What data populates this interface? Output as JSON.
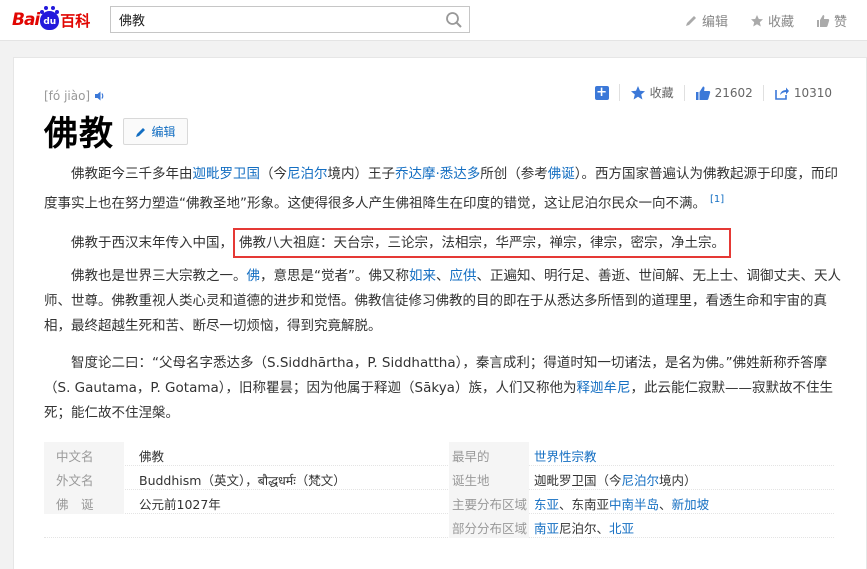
{
  "topbar": {
    "logo_bai": "Bai",
    "logo_du": "du",
    "logo_baike": "百科",
    "search_value": "佛教",
    "actions": {
      "edit": "编辑",
      "fav": "收藏",
      "like": "赞"
    }
  },
  "entry": {
    "pinyin": "[fó jiào]",
    "title": "佛教",
    "edit_label": "编辑",
    "tools": {
      "fav": "收藏",
      "likes": "21602",
      "shares": "10310"
    }
  },
  "paragraphs": {
    "p1": {
      "t1": "佛教距今三千多年由",
      "l1": "迦毗罗卫国",
      "t2": "（今",
      "l2": "尼泊尔",
      "t3": "境内）王子",
      "l3": "乔达摩·悉达多",
      "t4": "所创（参考",
      "l4": "佛诞",
      "t5": "）。西方国家普遍认为佛教起源于印度，而印度事实上也在努力塑造“佛教圣地”形象。这使得很多人产生佛祖降生在印度的错觉，这让尼泊尔民众一向不满。",
      "ref": "[1]"
    },
    "p2": {
      "t1": "佛教于西汉末年传入中国，",
      "highlight": "佛教八大祖庭：天台宗，三论宗，法相宗，华严宗，禅宗，律宗，密宗，净土宗。"
    },
    "p3": {
      "t1": "佛教也是世界三大宗教之一。",
      "l1": "佛",
      "t2": "，意思是“觉者”。佛又称",
      "l2": "如来",
      "t3": "、",
      "l3": "应供",
      "t4": "、正遍知、明行足、善逝、世间解、无上士、调御丈夫、天人师、世尊。佛教重视人类心灵和道德的进步和觉悟。佛教信徒修习佛教的目的即在于从悉达多所悟到的道理里，看透生命和宇宙的真相，最终超越生死和苦、断尽一切烦恼，得到究竟解脱。"
    },
    "p4": {
      "t1": "智度论二曰：“父母名字悉达多（S.Siddhārtha，P. Siddhattha），秦言成利；得道时知一切诸法，是名为佛。”佛姓新称乔答摩（S. Gautama，P. Gotama），旧称瞿昙；因为他属于释迦（Sākya）族，人们又称他为",
      "l1": "释迦牟尼",
      "t2": "，此云能仁寂默——寂默故不住生死；能仁故不住涅槃。"
    }
  },
  "info": {
    "r1": {
      "label": "中文名",
      "value": "佛教",
      "label2": "最早的",
      "v2a": "世界性",
      "v2b": "宗教"
    },
    "r2": {
      "label": "外文名",
      "value": "Buddhism（英文），बौद्धधर्मः（梵文）",
      "label2": "诞生地",
      "v2a": "迦毗罗卫国（今",
      "v2b": "尼泊尔",
      "v2c": "境内）"
    },
    "r3": {
      "label": "佛　诞",
      "value": "公元前1027年",
      "label2": "主要分布区域",
      "v2a": "东亚",
      "v2b": "、东南亚",
      "v2c": "中南半岛",
      "v2d": "、",
      "v2e": "新加坡"
    },
    "r4": {
      "label2": "部分分布区域",
      "v2a": "南亚",
      "v2b": "尼泊尔、",
      "v2c": "北亚"
    }
  },
  "colors": {
    "link": "#136ec2",
    "highlight_border": "#e53935",
    "logo_red": "#e10602",
    "logo_blue": "#2319dc"
  }
}
